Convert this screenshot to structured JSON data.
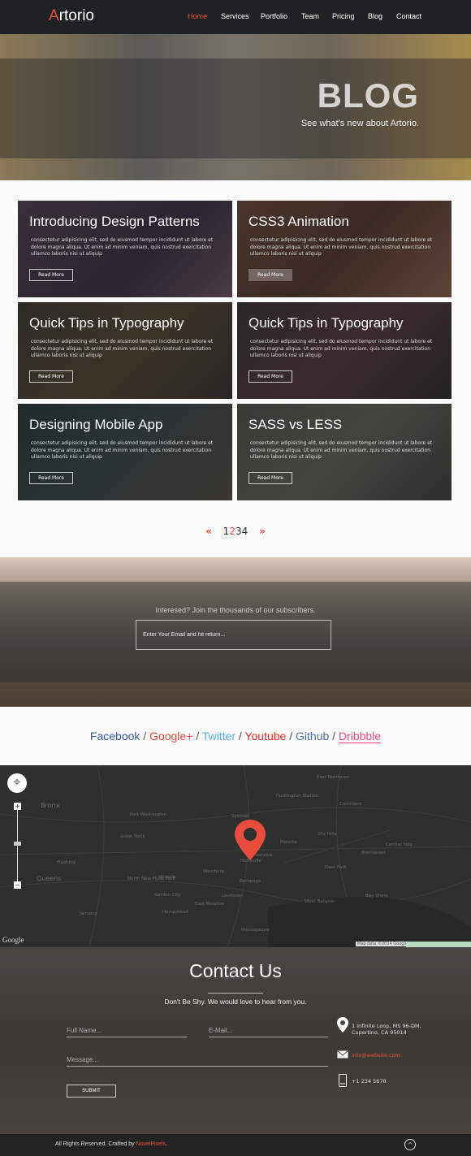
{
  "nav": {
    "logo_first": "A",
    "logo_rest": "rtorio",
    "items": [
      "Home",
      "Services",
      "Portfolio",
      "Team",
      "Pricing",
      "Blog",
      "Contact"
    ],
    "active": "Home"
  },
  "hero": {
    "title": "BLOG",
    "subtitle": "See what's new about Artorio."
  },
  "posts": [
    {
      "title": "Introducing Design Patterns",
      "excerpt": "consectetur adipisicing elit, sed do eiusmod tempor incididunt ut labore et dolore magna aliqua. Ut enim ad minim veniam, quis nostrud exercitation ullamco laboris nisi ut aliquip",
      "button": "Read More"
    },
    {
      "title": "CSS3 Animation",
      "excerpt": "consectetur adipisicing elit, sed do eiusmod tempor incididunt ut labore et dolore magna aliqua. Ut enim ad minim veniam, quis nostrud exercitation ullamco laboris nisi ut aliquip",
      "button": "Read More"
    },
    {
      "title": "Quick Tips in Typography",
      "excerpt": "consectetur adipisicing elit, sed do eiusmod tempor incididunt ut labore et dolore magna aliqua. Ut enim ad minim veniam, quis nostrud exercitation ullamco laboris nisi ut aliquip",
      "button": "Read More"
    },
    {
      "title": "Quick Tips in Typography",
      "excerpt": "consectetur adipisicing elit, sed do eiusmod tempor incididunt ut labore et dolore magna aliqua. Ut enim ad minim veniam, quis nostrud exercitation ullamco laboris nisi ut aliquip",
      "button": "Read More"
    },
    {
      "title": "Designing Mobile App",
      "excerpt": "consectetur adipisicing elit, sed do eiusmod tempor incididunt ut labore et dolore magna aliqua. Ut enim ad minim veniam, quis nostrud exercitation ullamco laboris nisi ut aliquip",
      "button": "Read More"
    },
    {
      "title": "SASS vs LESS",
      "excerpt": "consectetur adipisicing elit, sed do eiusmod tempor incididunt ut labore et dolore magna aliqua. Ut enim ad minim veniam, quis nostrud exercitation ullamco laboris nisi ut aliquip",
      "button": "Read More"
    }
  ],
  "pagination": {
    "prev": "«",
    "next": "»",
    "pages": [
      "1",
      "2",
      "3",
      "4"
    ],
    "current": "2"
  },
  "newsletter": {
    "text": "Interesed? Join the thousands of our subscribers.",
    "placeholder": "Enter Your Email and hit return..."
  },
  "social": [
    {
      "label": "Facebook",
      "color": "#3b5998"
    },
    {
      "label": "Google+",
      "color": "#dd4b39"
    },
    {
      "label": "Twitter",
      "color": "#55acee"
    },
    {
      "label": "Youtube",
      "color": "#e52d27"
    },
    {
      "label": "Github",
      "color": "#4a6fa5"
    },
    {
      "label": "Dribbble",
      "color": "#ea4c89"
    }
  ],
  "map": {
    "places": [
      "Bronx",
      "Queens",
      "Port Washington",
      "Great Neck",
      "Hicksville",
      "Westbury",
      "Garden City",
      "Levittown",
      "Bethpage",
      "Melville",
      "Huntington Station",
      "East Northport",
      "Commack",
      "Dix Hills",
      "Brentwood",
      "Central Islip",
      "Deer Park",
      "West Babylon",
      "Hempstead",
      "East Meadow",
      "Massapequa",
      "Jamaica",
      "Flushing",
      "Mineola",
      "North New Hyde Park",
      "Bay Shore",
      "Plainview",
      "Syosset"
    ],
    "attribution": "Map data ©2014 Google",
    "brand": "Google",
    "zoom_in": "+",
    "zoom_out": "−",
    "marker_color": "#e74c3c"
  },
  "contact": {
    "title": "Contact Us",
    "subtitle": "Don't Be Shy. We would love to hear from you.",
    "name_placeholder": "Full Name...",
    "email_placeholder": "E-Mail...",
    "message_placeholder": "Message...",
    "submit": "SUBMIT",
    "address_line1": "1 Infinite Loop, MS 96-DM,",
    "address_line2": "Cupertino, CA 95014",
    "email": "info@website.com",
    "phone": "+1 234 5678"
  },
  "footer": {
    "copy": "All Rights Reserved. Crafted by ",
    "author": "NovelPixels",
    "author_color": "#e74c3c",
    "dot": "."
  },
  "colors": {
    "accent": "#e74c3c",
    "nav_bg": "#1f2223"
  }
}
